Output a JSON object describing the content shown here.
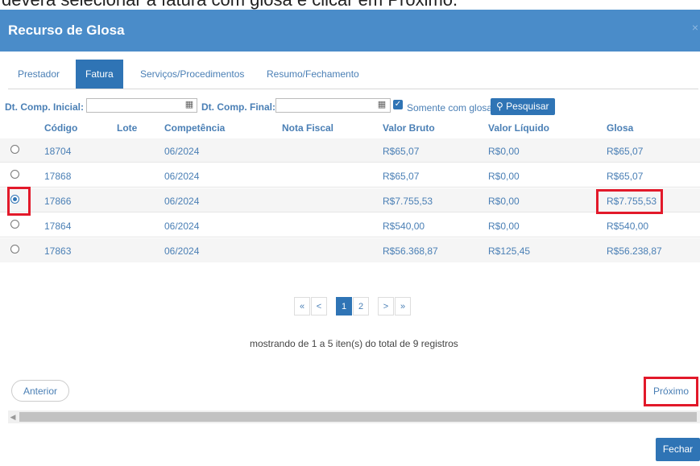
{
  "caption": "deverá selecionar a fatura com glosa e clicar em Próximo.",
  "modal": {
    "title": "Recurso de Glosa",
    "close_icon": "×"
  },
  "tabs": [
    {
      "label": "Prestador",
      "active": false
    },
    {
      "label": "Fatura",
      "active": true
    },
    {
      "label": "Serviços/Procedimentos",
      "active": false
    },
    {
      "label": "Resumo/Fechamento",
      "active": false
    }
  ],
  "filters": {
    "dt_inicial_label": "Dt. Comp. Inicial:",
    "dt_inicial_value": "",
    "dt_final_label": "Dt. Comp. Final:",
    "dt_final_value": "",
    "somente_label": "Somente com glosa",
    "somente_checked": true,
    "pesquisar_label": "Pesquisar"
  },
  "table": {
    "headers": [
      "Código",
      "Lote",
      "Competência",
      "Nota Fiscal",
      "Valor Bruto",
      "Valor Líquido",
      "Glosa"
    ],
    "rows": [
      {
        "codigo": "18704",
        "lote": "",
        "competencia": "06/2024",
        "nota_fiscal": "",
        "valor_bruto": "R$65,07",
        "valor_liquido": "R$0,00",
        "glosa": "R$65,07",
        "selected": false
      },
      {
        "codigo": "17868",
        "lote": "",
        "competencia": "06/2024",
        "nota_fiscal": "",
        "valor_bruto": "R$65,07",
        "valor_liquido": "R$0,00",
        "glosa": "R$65,07",
        "selected": false
      },
      {
        "codigo": "17866",
        "lote": "",
        "competencia": "06/2024",
        "nota_fiscal": "",
        "valor_bruto": "R$7.755,53",
        "valor_liquido": "R$0,00",
        "glosa": "R$7.755,53",
        "selected": true
      },
      {
        "codigo": "17864",
        "lote": "",
        "competencia": "06/2024",
        "nota_fiscal": "",
        "valor_bruto": "R$540,00",
        "valor_liquido": "R$0,00",
        "glosa": "R$540,00",
        "selected": false
      },
      {
        "codigo": "17863",
        "lote": "",
        "competencia": "06/2024",
        "nota_fiscal": "",
        "valor_bruto": "R$56.368,87",
        "valor_liquido": "R$125,45",
        "glosa": "R$56.238,87",
        "selected": false
      }
    ]
  },
  "pagination": {
    "first": "«",
    "prev": "<",
    "pages": [
      "1",
      "2"
    ],
    "current": "1",
    "next": ">",
    "last": "»",
    "info": "mostrando de 1 a 5 iten(s) do total de 9 registros"
  },
  "buttons": {
    "anterior": "Anterior",
    "proximo": "Próximo",
    "fechar": "Fechar"
  },
  "icons": {
    "calendar": "calendar-icon",
    "search": "search-icon",
    "check": "check-icon"
  },
  "colors": {
    "header": "#4a8cc9",
    "accent": "#2f74b5",
    "link": "#4a7fb5",
    "highlight": "#e2192a"
  }
}
